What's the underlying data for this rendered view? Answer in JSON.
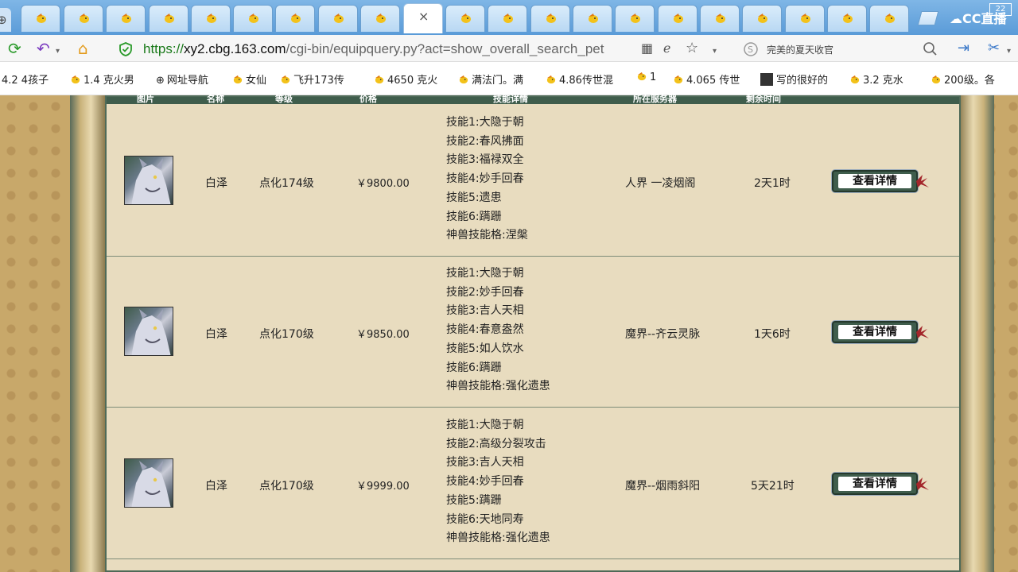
{
  "browser": {
    "url_scheme": "https://",
    "url_host": "xy2.cbg.163.com",
    "url_path": "/cgi-bin/equipquery.py?act=show_overall_search_pet",
    "search_text": "完美的夏天收官",
    "cloud_label": "CC直播",
    "badge": "22",
    "tab_close": "×"
  },
  "bookmarks": [
    "4.2 4孩子",
    "1.4 克火男",
    "网址导航",
    "女仙",
    "飞升173传",
    "4650 克火",
    "满法门。满",
    "4.86传世混",
    "1",
    "4.065 传世",
    "写的很好的",
    "3.2 克水",
    "200级。各"
  ],
  "table": {
    "headers": [
      "图片",
      "名称",
      "等级",
      "价格",
      "技能详情",
      "所在服务器",
      "剩余时间"
    ],
    "rows": [
      {
        "name": "白泽",
        "level": "点化174级",
        "price": "￥9800.00",
        "skills": [
          "技能1:大隐于朝",
          "技能2:春风拂面",
          "技能3:福禄双全",
          "技能4:妙手回春",
          "技能5:遗患",
          "技能6:蹒跚",
          "神兽技能格:涅槃"
        ],
        "server": "人界 一凌烟阁",
        "time": "2天1时",
        "button": "查看详情"
      },
      {
        "name": "白泽",
        "level": "点化170级",
        "price": "￥9850.00",
        "skills": [
          "技能1:大隐于朝",
          "技能2:妙手回春",
          "技能3:吉人天相",
          "技能4:春意盎然",
          "技能5:如人饮水",
          "技能6:蹒跚",
          "神兽技能格:强化遗患"
        ],
        "server": "魔界--齐云灵脉",
        "time": "1天6时",
        "button": "查看详情"
      },
      {
        "name": "白泽",
        "level": "点化170级",
        "price": "￥9999.00",
        "skills": [
          "技能1:大隐于朝",
          "技能2:高级分裂攻击",
          "技能3:吉人天相",
          "技能4:妙手回春",
          "技能5:蹒跚",
          "技能6:天地同寿",
          "神兽技能格:强化遗患"
        ],
        "server": "魔界--烟雨斜阳",
        "time": "5天21时",
        "button": "查看详情"
      }
    ]
  }
}
